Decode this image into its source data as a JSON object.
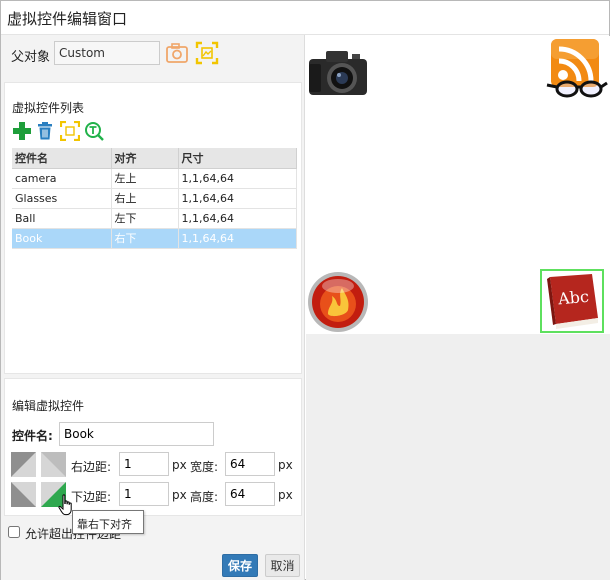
{
  "window": {
    "title": "虚拟控件编辑窗口"
  },
  "parent": {
    "label": "父对象",
    "value": "Custom"
  },
  "list": {
    "heading": "虚拟控件列表",
    "columns": [
      "控件名",
      "对齐",
      "尺寸"
    ],
    "rows": [
      {
        "name": "camera",
        "align": "左上",
        "size": "1,1,64,64"
      },
      {
        "name": "Glasses",
        "align": "右上",
        "size": "1,1,64,64"
      },
      {
        "name": "Ball",
        "align": "左下",
        "size": "1,1,64,64"
      },
      {
        "name": "Book",
        "align": "右下",
        "size": "1,1,64,64"
      }
    ],
    "selected_index": 3
  },
  "edit": {
    "heading": "编辑虚拟控件",
    "name_label": "控件名:",
    "name_value": "Book",
    "right_margin_label": "右边距:",
    "right_margin_value": "1",
    "width_label": "宽度:",
    "width_value": "64",
    "bottom_margin_label": "下边距:",
    "bottom_margin_value": "1",
    "height_label": "高度:",
    "height_value": "64",
    "unit": "px"
  },
  "tooltip": {
    "text": "靠右下对齐"
  },
  "overflow": {
    "label": "允许超出控件边距",
    "checked": false
  },
  "buttons": {
    "save": "保存",
    "cancel": "取消"
  },
  "book": {
    "title": "Abc"
  },
  "colors": {
    "accent": "#337ab7",
    "selected_row": "#aad7f9",
    "selection_outline": "#5ee05e"
  }
}
